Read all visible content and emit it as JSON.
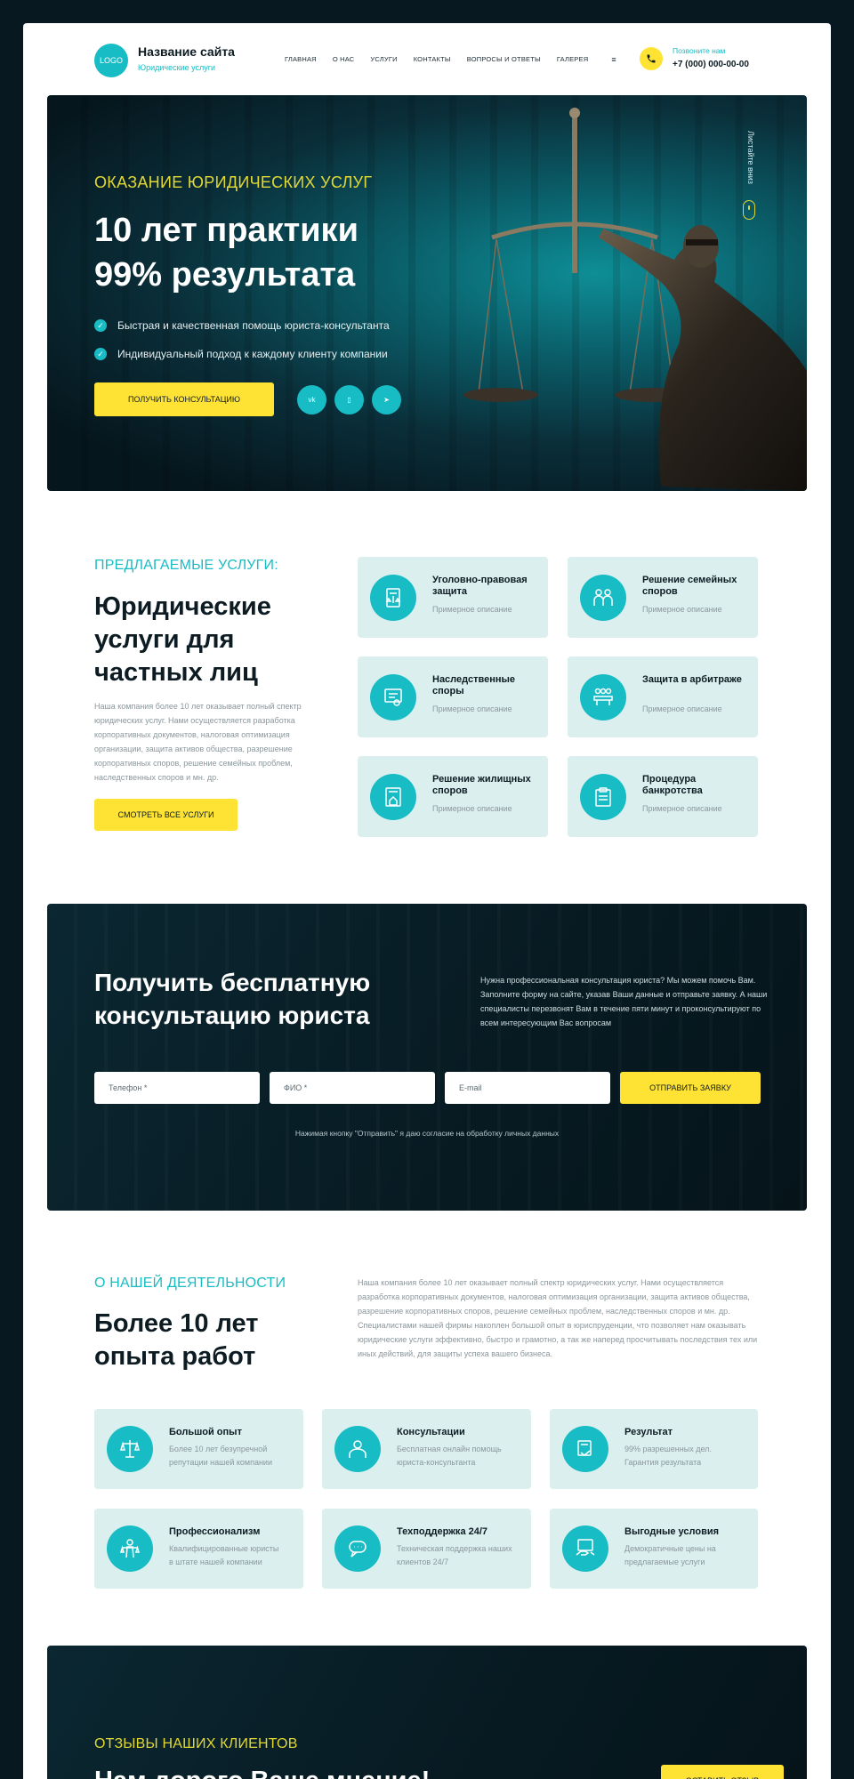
{
  "header": {
    "logo": "LOGO",
    "site_name": "Название сайта",
    "site_sub": "Юридические услуги",
    "nav": [
      "ГЛАВНАЯ",
      "О НАС",
      "УСЛУГИ",
      "КОНТАКТЫ",
      "ВОПРОСЫ И ОТВЕТЫ",
      "ГАЛЕРЕЯ"
    ],
    "menu_icon": "≡",
    "call_label": "Позвоните нам",
    "phone": "+7 (000) 000-00-00"
  },
  "hero": {
    "kicker": "ОКАЗАНИЕ ЮРИДИЧЕСКИХ УСЛУГ",
    "title_line1": "10 лет практики",
    "title_line2": "99% результата",
    "bullets": [
      "Быстрая и качественная помощь юриста-консультанта",
      "Индивидуальный подход к каждому клиенту компании"
    ],
    "cta": "ПОЛУЧИТЬ КОНСУЛЬТАЦИЮ",
    "socials": [
      "vk",
      "viber",
      "telegram"
    ],
    "social_glyphs": [
      "vk",
      "▯",
      "➤"
    ],
    "scroll": "Листайте вниз"
  },
  "services": {
    "kicker": "ПРЕДЛАГАЕМЫЕ УСЛУГИ:",
    "title_line1": "Юридические",
    "title_line2": "услуги для",
    "title_line3": "частных лиц",
    "text": "Наша компания более 10 лет оказывает полный спектр юридических услуг. Нами осуществляется разработка корпоративных документов, налоговая оптимизация организации, защита активов общества, разрешение корпоративных споров, решение семейных проблем, наследственных споров и мн. др.",
    "cta": "СМОТРЕТЬ ВСЕ УСЛУГИ",
    "cards": [
      {
        "title": "Уголовно-правовая защита",
        "desc": "Примерное описание",
        "icon": "scales-document-icon"
      },
      {
        "title": "Решение семейных споров",
        "desc": "Примерное описание",
        "icon": "family-icon"
      },
      {
        "title": "Наследственные споры",
        "desc": "Примерное описание",
        "icon": "certificate-icon"
      },
      {
        "title": "Защита в арбитраже",
        "desc": "Примерное описание",
        "icon": "meeting-icon"
      },
      {
        "title": "Решение жилищных споров",
        "desc": "Примерное описание",
        "icon": "house-document-icon"
      },
      {
        "title": "Процедура банкротства",
        "desc": "Примерное описание",
        "icon": "clipboard-icon"
      }
    ]
  },
  "consult": {
    "title_line1": "Получить бесплатную",
    "title_line2": "консультацию юриста",
    "text": "Нужна профессиональная консультация юриста? Мы можем помочь Вам. Заполните форму на сайте, указав Ваши данные и отправьте заявку. А наши специалисты перезвонят Вам в течение пяти минут и проконсультируют по всем интересующим Вас вопросам",
    "phone_placeholder": "Телефон *",
    "name_placeholder": "ФИО *",
    "email_placeholder": "E-mail",
    "submit": "ОТПРАВИТЬ ЗАЯВКУ",
    "note": "Нажимая кнопку \"Отправить\" я даю согласие на обработку личных данных"
  },
  "about": {
    "kicker": "О НАШЕЙ ДЕЯТЕЛЬНОСТИ",
    "title_line1": "Более 10 лет",
    "title_line2": "опыта работ",
    "text": "Наша компания более 10 лет оказывает полный спектр юридических услуг. Нами осуществляется разработка корпоративных документов, налоговая оптимизация организации, защита активов общества, разрешение корпоративных споров, решение семейных проблем, наследственных споров и мн. др. Специалистами нашей фирмы накоплен большой опыт в юриспруденции, что позволяет нам оказывать юридические услуги эффективно, быстро и грамотно, а так же наперед просчитывать последствия тех или иных действий, для защиты успеха вашего бизнеса.",
    "cards": [
      {
        "title": "Большой опыт",
        "desc": "Более 10 лет безупречной репутации нашей компании",
        "icon": "scales-icon"
      },
      {
        "title": "Консультации",
        "desc": "Бесплатная онлайн помощь юриста-консультанта",
        "icon": "lawyer-icon"
      },
      {
        "title": "Результат",
        "desc": "99% разрешенных дел. Гарантия результата",
        "icon": "handshake-icon"
      },
      {
        "title": "Профессионализм",
        "desc": "Квалифицированные юристы в штате нашей компании",
        "icon": "justice-icon"
      },
      {
        "title": "Техподдержка 24/7",
        "desc": "Техническая поддержка наших клиентов 24/7",
        "icon": "support-icon"
      },
      {
        "title": "Выгодные условия",
        "desc": "Демократичные цены на предлагаемые услуги",
        "icon": "deal-icon"
      }
    ]
  },
  "reviews": {
    "kicker": "ОТЗЫВЫ НАШИХ КЛИЕНТОВ",
    "title": "Нам дорого Ваше мнение!",
    "cta": "ОСТАВИТЬ ОТЗЫВ"
  },
  "colors": {
    "accent": "#18bcc4",
    "yellow": "#ffe334",
    "dark": "#071820",
    "card_bg": "#dcefef"
  }
}
